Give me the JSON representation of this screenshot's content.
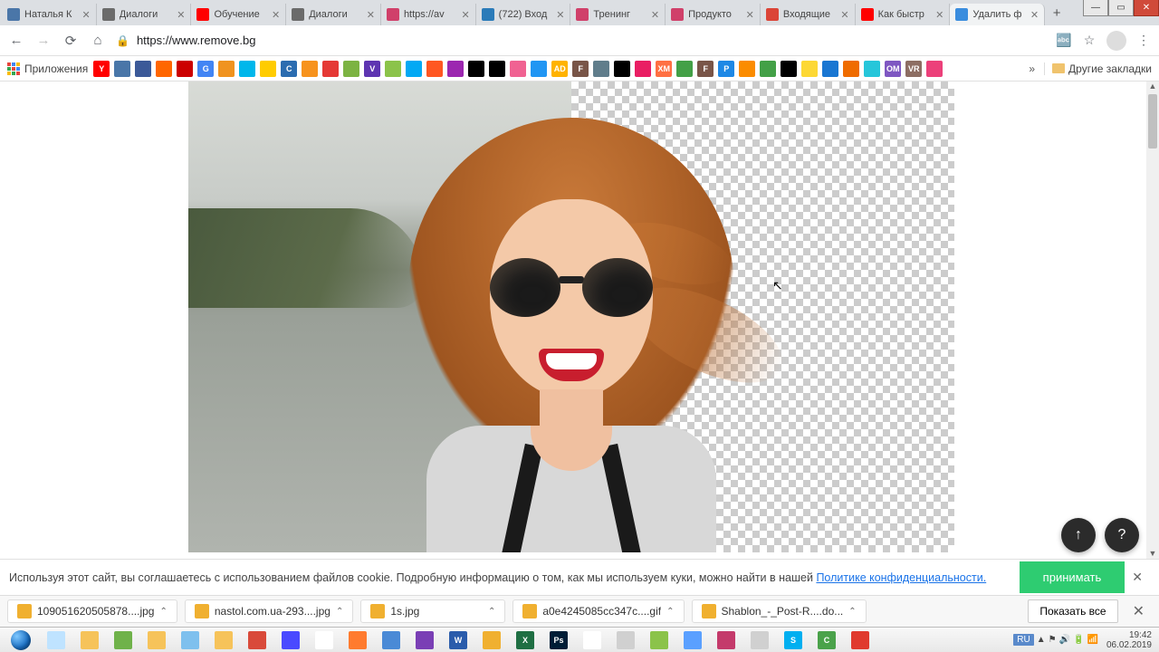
{
  "window_controls": {
    "min": "—",
    "max": "▭",
    "close": "✕"
  },
  "tabs": [
    {
      "title": "Наталья К",
      "fav": "#4a76a8"
    },
    {
      "title": "Диалоги",
      "fav": "#6b6b6b"
    },
    {
      "title": "Обучение",
      "fav": "#ff0000"
    },
    {
      "title": "Диалоги",
      "fav": "#6b6b6b"
    },
    {
      "title": "https://av",
      "fav": "#d0406a"
    },
    {
      "title": "(722) Вход",
      "fav": "#2b7bb9"
    },
    {
      "title": "Тренинг",
      "fav": "#d0406a"
    },
    {
      "title": "Продукто",
      "fav": "#d0406a"
    },
    {
      "title": "Входящие",
      "fav": "#db4437"
    },
    {
      "title": "Как быстр",
      "fav": "#ff0000"
    },
    {
      "title": "Удалить ф",
      "fav": "#3a8dde",
      "active": true
    }
  ],
  "new_tab": "+",
  "nav": {
    "back": "←",
    "forward": "→",
    "reload": "⟳",
    "home": "⌂"
  },
  "url": "https://www.remove.bg",
  "addr_icons": {
    "translate": "🔤",
    "star": "☆",
    "menu": "⋮"
  },
  "bookmarks": {
    "apps_label": "Приложения",
    "chevron": "»",
    "other_label": "Другие закладки",
    "icons": [
      {
        "c": "#ff0000",
        "t": "Y"
      },
      {
        "c": "#4a76a8",
        "t": ""
      },
      {
        "c": "#3b5998",
        "t": ""
      },
      {
        "c": "#ff6600",
        "t": ""
      },
      {
        "c": "#cc0000",
        "t": ""
      },
      {
        "c": "#4285f4",
        "t": "G"
      },
      {
        "c": "#f0931f",
        "t": ""
      },
      {
        "c": "#00b7eb",
        "t": ""
      },
      {
        "c": "#ffcc00",
        "t": ""
      },
      {
        "c": "#2b6cb0",
        "t": "C"
      },
      {
        "c": "#f7931e",
        "t": ""
      },
      {
        "c": "#e53935",
        "t": ""
      },
      {
        "c": "#7cb342",
        "t": ""
      },
      {
        "c": "#5e35b1",
        "t": "V"
      },
      {
        "c": "#8bc34a",
        "t": ""
      },
      {
        "c": "#03a9f4",
        "t": ""
      },
      {
        "c": "#ff5722",
        "t": ""
      },
      {
        "c": "#9c27b0",
        "t": ""
      },
      {
        "c": "#000000",
        "t": ""
      },
      {
        "c": "#000000",
        "t": ""
      },
      {
        "c": "#f06292",
        "t": ""
      },
      {
        "c": "#2196f3",
        "t": ""
      },
      {
        "c": "#ffb300",
        "t": "AD"
      },
      {
        "c": "#795548",
        "t": "F"
      },
      {
        "c": "#607d8b",
        "t": ""
      },
      {
        "c": "#000000",
        "t": ""
      },
      {
        "c": "#e91e63",
        "t": ""
      },
      {
        "c": "#ff7043",
        "t": "XM"
      },
      {
        "c": "#43a047",
        "t": ""
      },
      {
        "c": "#795548",
        "t": "F"
      },
      {
        "c": "#1e88e5",
        "t": "P"
      },
      {
        "c": "#fb8c00",
        "t": ""
      },
      {
        "c": "#43a047",
        "t": ""
      },
      {
        "c": "#000000",
        "t": ""
      },
      {
        "c": "#fdd835",
        "t": ""
      },
      {
        "c": "#1976d2",
        "t": ""
      },
      {
        "c": "#ef6c00",
        "t": ""
      },
      {
        "c": "#26c6da",
        "t": ""
      },
      {
        "c": "#7e57c2",
        "t": "OM"
      },
      {
        "c": "#8d6e63",
        "t": "VR"
      },
      {
        "c": "#ec407a",
        "t": ""
      }
    ]
  },
  "cookie": {
    "text": "Используя этот сайт, вы соглашаетесь с использованием файлов cookie. Подробную информацию о том, как мы используем куки, можно найти в нашей",
    "link": "Политике конфиденциальности.",
    "accept": "принимать",
    "close": "✕"
  },
  "fab": {
    "up": "↑",
    "help": "?"
  },
  "downloads": {
    "items": [
      {
        "name": "109051620505878....jpg"
      },
      {
        "name": "nastol.com.ua-293....jpg"
      },
      {
        "name": "1s.jpg"
      },
      {
        "name": "a0e4245085cc347c....gif"
      },
      {
        "name": "Shablon_-_Post-R....do..."
      }
    ],
    "show_all": "Показать все",
    "close": "✕",
    "chev": "⌃"
  },
  "taskbar": {
    "icons": [
      {
        "c": "#bfe3ff"
      },
      {
        "c": "#f6c35a"
      },
      {
        "c": "#6fb24a"
      },
      {
        "c": "#f6c35a"
      },
      {
        "c": "#7ec0ee"
      },
      {
        "c": "#f6c35a"
      },
      {
        "c": "#d94a3a"
      },
      {
        "c": "#4a4aff"
      },
      {
        "c": "#ffffff"
      },
      {
        "c": "#ff7b2e"
      },
      {
        "c": "#4a8ad6"
      },
      {
        "c": "#7a3fb5"
      },
      {
        "c": "#2a5cab",
        "t": "W"
      },
      {
        "c": "#f0b030"
      },
      {
        "c": "#1f6f43",
        "t": "X"
      },
      {
        "c": "#001d36",
        "t": "Ps"
      },
      {
        "c": "#ffffff"
      },
      {
        "c": "#d0d0d0"
      },
      {
        "c": "#8bc34a"
      },
      {
        "c": "#5aa0ff"
      },
      {
        "c": "#c43a6b"
      },
      {
        "c": "#d0d0d0"
      },
      {
        "c": "#00aff0",
        "t": "S"
      },
      {
        "c": "#4aa24a",
        "t": "C"
      },
      {
        "c": "#e03a2e"
      }
    ],
    "tray_icons": [
      "▲",
      "⚑",
      "🔊",
      "🔋",
      "📶"
    ],
    "lang": "RU",
    "time": "19:42",
    "date": "06.02.2019"
  }
}
